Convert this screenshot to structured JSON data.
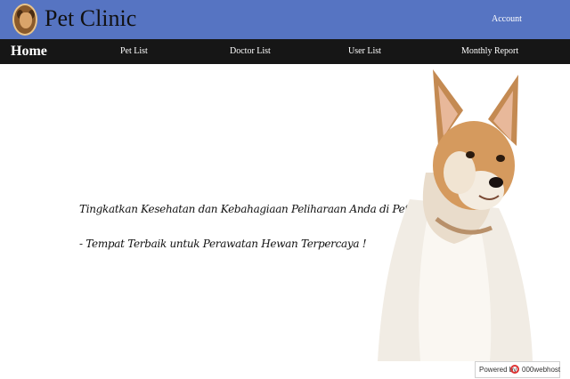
{
  "header": {
    "site_title": "Pet Clinic",
    "account_label": "Account"
  },
  "nav": {
    "home": "Home",
    "pet_list": "Pet List",
    "doctor_list": "Doctor List",
    "user_list": "User List",
    "monthly_report": "Monthly Report"
  },
  "hero": {
    "line1": "Tingkatkan Kesehatan dan Kebahagiaan Peliharaan Anda di Pet Clinic",
    "line2": "- Tempat Terbaik untuk Perawatan Hewan Terpercaya !"
  },
  "footer": {
    "powered_by": "Powered by",
    "brand": "000webhost"
  },
  "colors": {
    "header_bg": "#5674c2",
    "nav_bg": "#161616"
  },
  "icons": [
    "pet-clinic-logo-icon",
    "dog-photo",
    "webhost-logo-icon"
  ]
}
